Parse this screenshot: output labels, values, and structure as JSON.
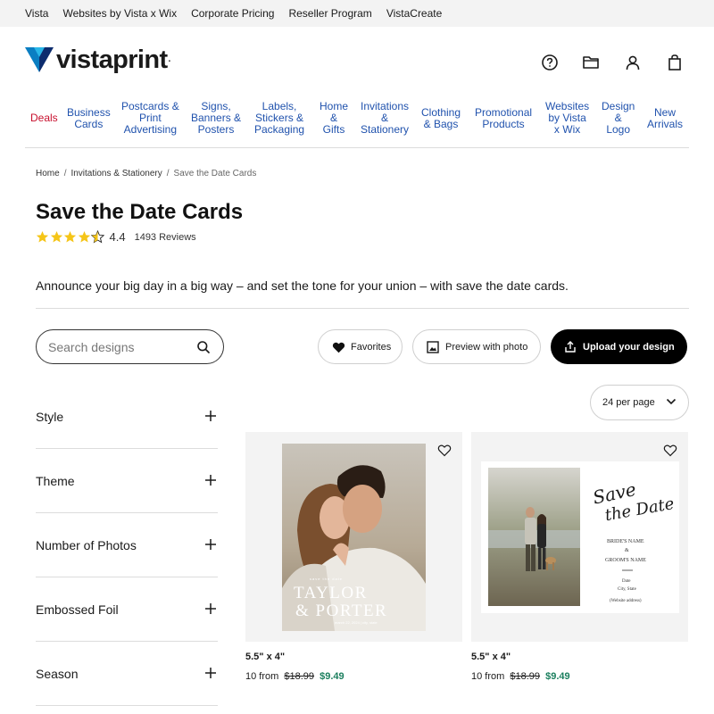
{
  "top_links": [
    "Vista",
    "Websites by Vista x Wix",
    "Corporate Pricing",
    "Reseller Program",
    "VistaCreate"
  ],
  "logo": {
    "text": "vistaprint",
    "dot": "."
  },
  "header_icons": [
    "help-icon",
    "folder-icon",
    "account-icon",
    "cart-icon"
  ],
  "nav": [
    "Deals",
    "Business\nCards",
    "Postcards &\nPrint\nAdvertising",
    "Signs,\nBanners &\nPosters",
    "Labels,\nStickers &\nPackaging",
    "Home\n&\nGifts",
    "Invitations\n&\nStationery",
    "Clothing\n& Bags",
    "Promotional\nProducts",
    "Websites\nby Vista\nx Wix",
    "Design\n&\nLogo",
    "New\nArrivals"
  ],
  "breadcrumb": [
    "Home",
    "Invitations & Stationery",
    "Save the Date Cards"
  ],
  "page_title": "Save the Date Cards",
  "rating": {
    "value": "4.4",
    "stars": 4.4,
    "reviews": "1493 Reviews"
  },
  "description": "Announce your big day in a big way – and set the tone for your union – with save the date cards.",
  "search": {
    "placeholder": "Search designs"
  },
  "buttons": {
    "favorites": "Favorites",
    "preview": "Preview with photo",
    "upload": "Upload your design"
  },
  "per_page": "24 per page",
  "filters": [
    "Style",
    "Theme",
    "Number of Photos",
    "Embossed Foil",
    "Season"
  ],
  "products": [
    {
      "size": "5.5\" x 4\"",
      "price_prefix": "10 from",
      "old_price": "$18.99",
      "new_price": "$9.49",
      "card": {
        "small_line": "save the date",
        "name1": "TAYLOR",
        "name2": "& PORTER",
        "date_line": "march 22, 2024 | city, state"
      }
    },
    {
      "size": "5.5\" x 4\"",
      "price_prefix": "10 from",
      "old_price": "$18.99",
      "new_price": "$9.49",
      "card": {
        "script1": "Save",
        "script2": "the Date",
        "bride": "BRIDE'S NAME",
        "amp": "&",
        "groom": "GROOM'S NAME",
        "date": "Date",
        "city": "City, State",
        "website": "(Website address)"
      }
    }
  ],
  "colors": {
    "nav_link": "#2052ad",
    "deals": "#c8102e",
    "sale_price": "#1b7f5e",
    "star": "#f5c518",
    "upload_bg": "#000000"
  }
}
